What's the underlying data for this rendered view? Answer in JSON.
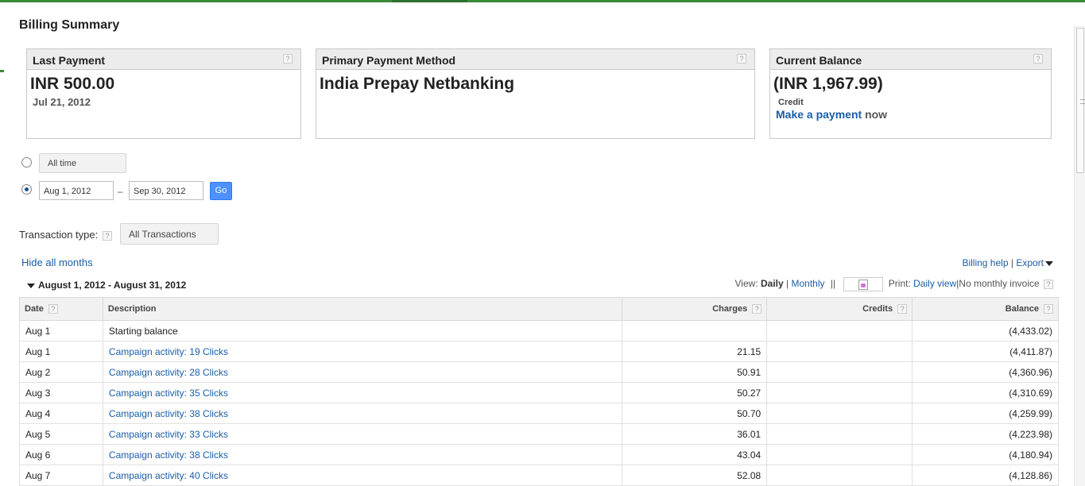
{
  "page": {
    "title": "Billing Summary"
  },
  "panels": {
    "last_payment": {
      "heading": "Last Payment",
      "amount": "INR 500.00",
      "date": "Jul 21, 2012"
    },
    "primary_method": {
      "heading": "Primary Payment Method",
      "value": "India Prepay Netbanking"
    },
    "current_balance": {
      "heading": "Current Balance",
      "amount": "(INR 1,967.99)",
      "note": "Credit",
      "make_payment": "Make a payment",
      "now": "now"
    }
  },
  "help_glyph": "?",
  "date_filter": {
    "all_time_label": "All time",
    "start_date": "Aug 1, 2012",
    "separator": "–",
    "end_date": "Sep 30, 2012",
    "go_label": "Go",
    "selected": "range"
  },
  "transaction_type": {
    "label": "Transaction type:",
    "value": "All Transactions"
  },
  "links": {
    "hide_months": "Hide all months",
    "billing_help": "Billing help",
    "separator": "|",
    "export": "Export"
  },
  "month": {
    "label": "August 1, 2012 - August 31, 2012"
  },
  "view": {
    "label": "View:",
    "daily": "Daily",
    "sep": "|",
    "monthly": "Monthly",
    "divider": "||",
    "print_label": "Print:",
    "daily_view": "Daily view",
    "no_invoice": "|No monthly invoice"
  },
  "table": {
    "headers": {
      "date": "Date",
      "description": "Description",
      "charges": "Charges",
      "credits": "Credits",
      "balance": "Balance"
    },
    "rows": [
      {
        "date": "Aug 1",
        "description": "Starting balance",
        "link": false,
        "charges": "",
        "credits": "",
        "balance": "(4,433.02)"
      },
      {
        "date": "Aug 1",
        "description": "Campaign activity: 19 Clicks",
        "link": true,
        "charges": "21.15",
        "credits": "",
        "balance": "(4,411.87)"
      },
      {
        "date": "Aug 2",
        "description": "Campaign activity: 28 Clicks",
        "link": true,
        "charges": "50.91",
        "credits": "",
        "balance": "(4,360.96)"
      },
      {
        "date": "Aug 3",
        "description": "Campaign activity: 35 Clicks",
        "link": true,
        "charges": "50.27",
        "credits": "",
        "balance": "(4,310.69)"
      },
      {
        "date": "Aug 4",
        "description": "Campaign activity: 38 Clicks",
        "link": true,
        "charges": "50.70",
        "credits": "",
        "balance": "(4,259.99)"
      },
      {
        "date": "Aug 5",
        "description": "Campaign activity: 33 Clicks",
        "link": true,
        "charges": "36.01",
        "credits": "",
        "balance": "(4,223.98)"
      },
      {
        "date": "Aug 6",
        "description": "Campaign activity: 38 Clicks",
        "link": true,
        "charges": "43.04",
        "credits": "",
        "balance": "(4,180.94)"
      },
      {
        "date": "Aug 7",
        "description": "Campaign activity: 40 Clicks",
        "link": true,
        "charges": "52.08",
        "credits": "",
        "balance": "(4,128.86)"
      }
    ]
  },
  "colors": {
    "link": "#1a5ea8",
    "go_button": "#4d90fe",
    "top_bar": "#3a8a3a"
  }
}
